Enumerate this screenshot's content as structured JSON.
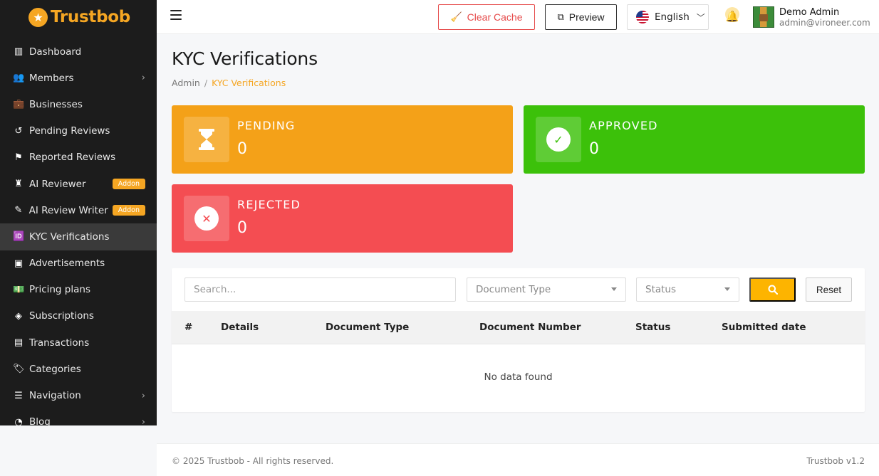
{
  "brand": {
    "name": "Trustbob"
  },
  "sidebar": {
    "items": [
      {
        "icon": "dashboard-icon",
        "glyph": "▥",
        "label": "Dashboard",
        "chevron": false,
        "badge": ""
      },
      {
        "icon": "users-icon",
        "glyph": "👥",
        "label": "Members",
        "chevron": true,
        "badge": ""
      },
      {
        "icon": "briefcase-icon",
        "glyph": "💼",
        "label": "Businesses",
        "chevron": false,
        "badge": ""
      },
      {
        "icon": "history-icon",
        "glyph": "↺",
        "label": "Pending Reviews",
        "chevron": false,
        "badge": ""
      },
      {
        "icon": "flag-icon",
        "glyph": "⚑",
        "label": "Reported Reviews",
        "chevron": false,
        "badge": ""
      },
      {
        "icon": "robot-icon",
        "glyph": "♜",
        "label": "AI Reviewer",
        "chevron": false,
        "badge": "Addon"
      },
      {
        "icon": "pen-icon",
        "glyph": "✎",
        "label": "AI Review Writer",
        "chevron": false,
        "badge": "Addon"
      },
      {
        "icon": "id-card-icon",
        "glyph": "🆔",
        "label": "KYC Verifications",
        "chevron": false,
        "badge": "",
        "active": true
      },
      {
        "icon": "ad-icon",
        "glyph": "▣",
        "label": "Advertisements",
        "chevron": false,
        "badge": ""
      },
      {
        "icon": "money-icon",
        "glyph": "💵",
        "label": "Pricing plans",
        "chevron": false,
        "badge": ""
      },
      {
        "icon": "gem-icon",
        "glyph": "◈",
        "label": "Subscriptions",
        "chevron": false,
        "badge": ""
      },
      {
        "icon": "receipt-icon",
        "glyph": "▤",
        "label": "Transactions",
        "chevron": false,
        "badge": ""
      },
      {
        "icon": "tags-icon",
        "glyph": "🏷",
        "label": "Categories",
        "chevron": false,
        "badge": ""
      },
      {
        "icon": "list-icon",
        "glyph": "☰",
        "label": "Navigation",
        "chevron": true,
        "badge": ""
      },
      {
        "icon": "rss-icon",
        "glyph": "◔",
        "label": "Blog",
        "chevron": true,
        "badge": ""
      }
    ]
  },
  "topbar": {
    "clear_cache_label": "Clear Cache",
    "preview_label": "Preview",
    "language": "English",
    "user_name": "Demo Admin",
    "user_email": "admin@vironeer.com"
  },
  "page": {
    "title": "KYC Verifications",
    "breadcrumb": {
      "root": "Admin",
      "current": "KYC Verifications"
    }
  },
  "stats": {
    "pending": {
      "label": "PENDING",
      "value": "0"
    },
    "approved": {
      "label": "APPROVED",
      "value": "0"
    },
    "rejected": {
      "label": "REJECTED",
      "value": "0"
    }
  },
  "filters": {
    "search_placeholder": "Search...",
    "document_type": "Document Type",
    "status": "Status",
    "reset_label": "Reset"
  },
  "table": {
    "columns": [
      "#",
      "Details",
      "Document Type",
      "Document Number",
      "Status",
      "Submitted date"
    ],
    "empty_text": "No data found"
  },
  "footer": {
    "copyright": "© 2025 Trustbob - All rights reserved.",
    "version": "Trustbob v1.2"
  },
  "colors": {
    "accent": "#f5a623",
    "pending": "#f4a118",
    "approved": "#3cc10a",
    "rejected": "#f44d52",
    "danger": "#e64b4b"
  }
}
